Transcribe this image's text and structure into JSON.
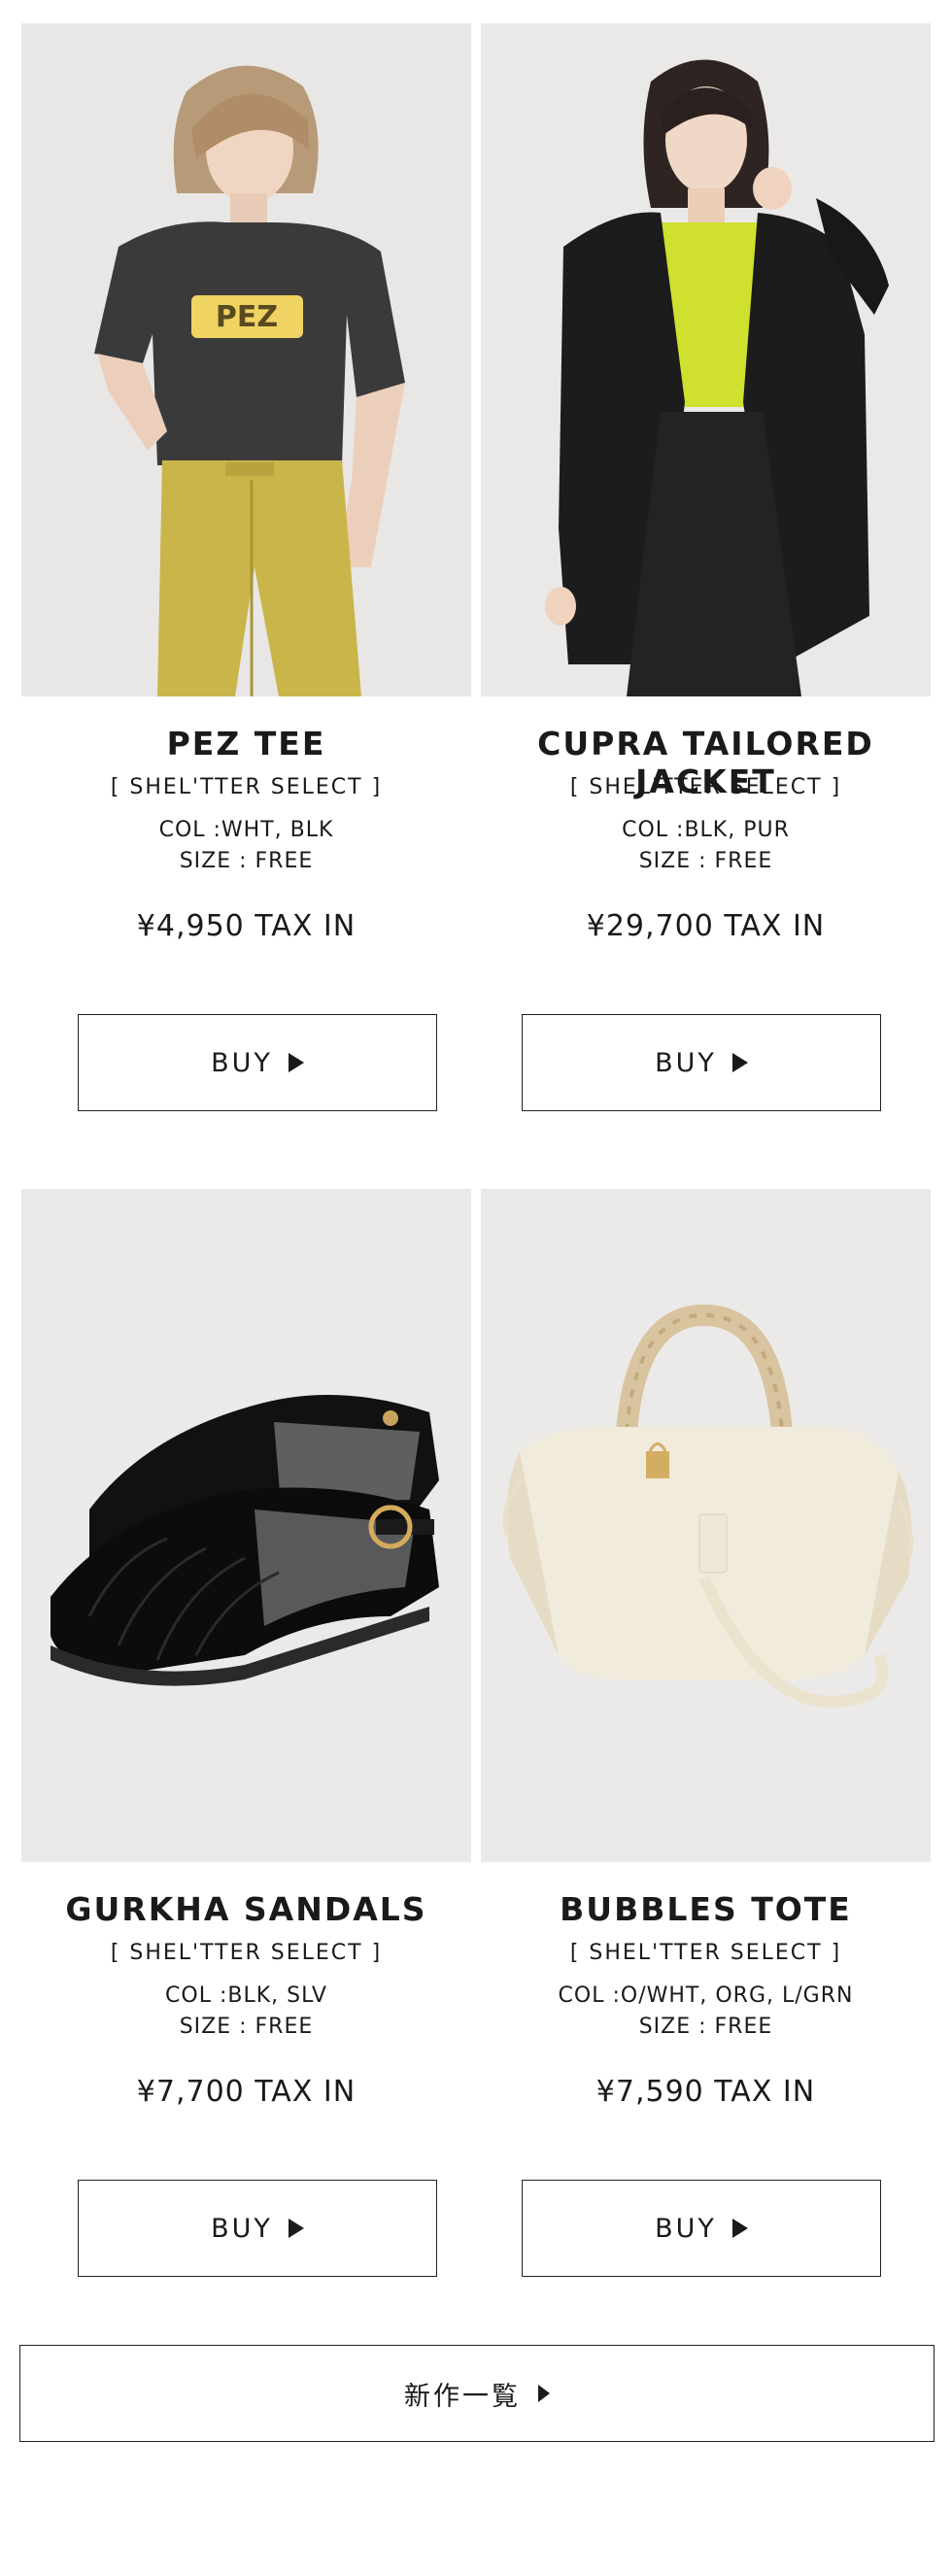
{
  "products": [
    {
      "name": "PEZ TEE",
      "brand": "[ SHEL'TTER SELECT  ]",
      "col": "COL :WHT, BLK",
      "size": "SIZE : FREE",
      "price": "¥4,950 TAX IN",
      "buy_label": "BUY",
      "tee_print": "PEZ"
    },
    {
      "name": "CUPRA TAILORED JACKET",
      "brand": "[ SHEL'TTER SELECT ]",
      "col": "COL :BLK, PUR",
      "size": "SIZE : FREE",
      "price": "¥29,700 TAX IN",
      "buy_label": "BUY"
    },
    {
      "name": "GURKHA SANDALS",
      "brand": "[ SHEL'TTER SELECT ]",
      "col": "COL :BLK, SLV",
      "size": "SIZE : FREE",
      "price": "¥7,700 TAX IN",
      "buy_label": "BUY"
    },
    {
      "name": "BUBBLES TOTE",
      "brand": "[ SHEL'TTER SELECT ]",
      "col": "COL :O/WHT, ORG, L/GRN",
      "size": "SIZE : FREE",
      "price": "¥7,590 TAX IN",
      "buy_label": "BUY"
    }
  ],
  "all_new_label": "新作一覧",
  "icons": {
    "buy_arrow": "play-triangle-icon",
    "more_arrow": "caret-right-icon"
  },
  "colors": {
    "text": "#1a1a1a",
    "photo_bg": "#ebe9e8",
    "border": "#222222"
  }
}
